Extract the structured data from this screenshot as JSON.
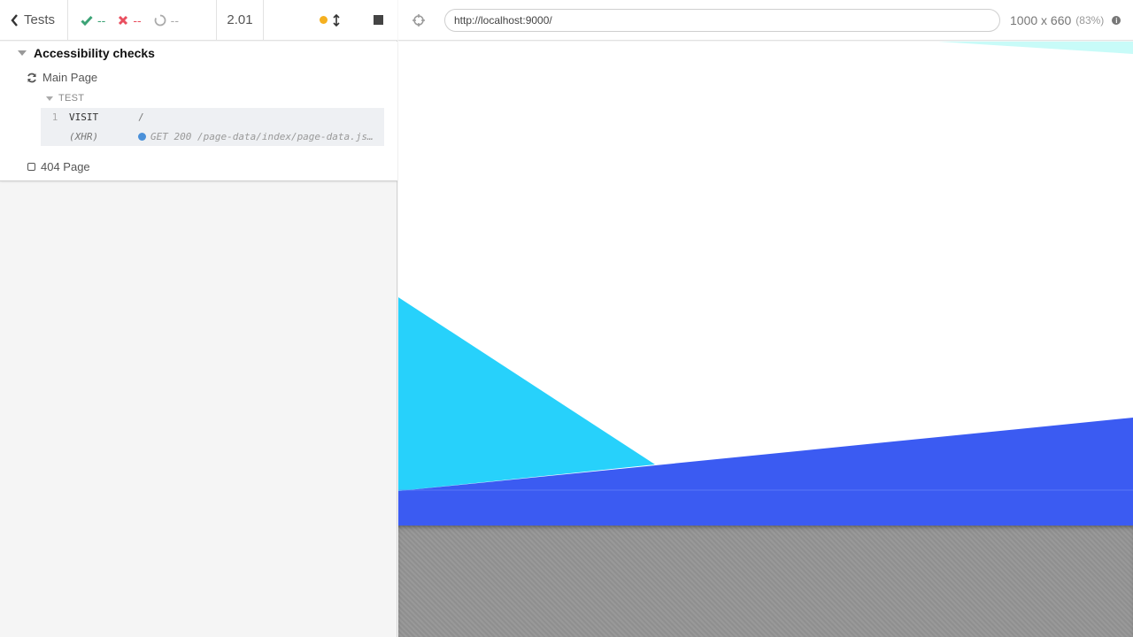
{
  "reporter": {
    "back_label": "Tests",
    "stats": {
      "passed": "--",
      "failed": "--",
      "pending": "--"
    },
    "duration": "2.01",
    "suite_title": "Accessibility checks",
    "tests": [
      {
        "title": "Main Page",
        "state": "running"
      },
      {
        "title": "404 Page",
        "state": "pending"
      }
    ],
    "section_label": "TEST",
    "commands": [
      {
        "number": "1",
        "name": "VISIT",
        "message": "/"
      },
      {
        "number": "",
        "name": "(XHR)",
        "message": "GET 200 /page-data/index/page-data.json"
      }
    ]
  },
  "aut": {
    "url": "http://localhost:9000/",
    "viewport": "1000 x 660",
    "zoom": "(83%)"
  },
  "colors": {
    "cyan": "#27d1fb",
    "blue": "#3b5bf2",
    "light_cyan": "#c8fbf8",
    "passed": "#3ca376",
    "failed": "#e94f5f",
    "running": "#f5b020"
  },
  "icons": {
    "back": "chevron-left-icon",
    "passed": "check-icon",
    "failed": "x-icon",
    "pending": "circle-notch-icon",
    "scroll": "arrows-v-icon",
    "stop": "stop-icon",
    "refresh": "refresh-icon",
    "selector": "crosshairs-icon",
    "info": "info-circle-icon"
  }
}
